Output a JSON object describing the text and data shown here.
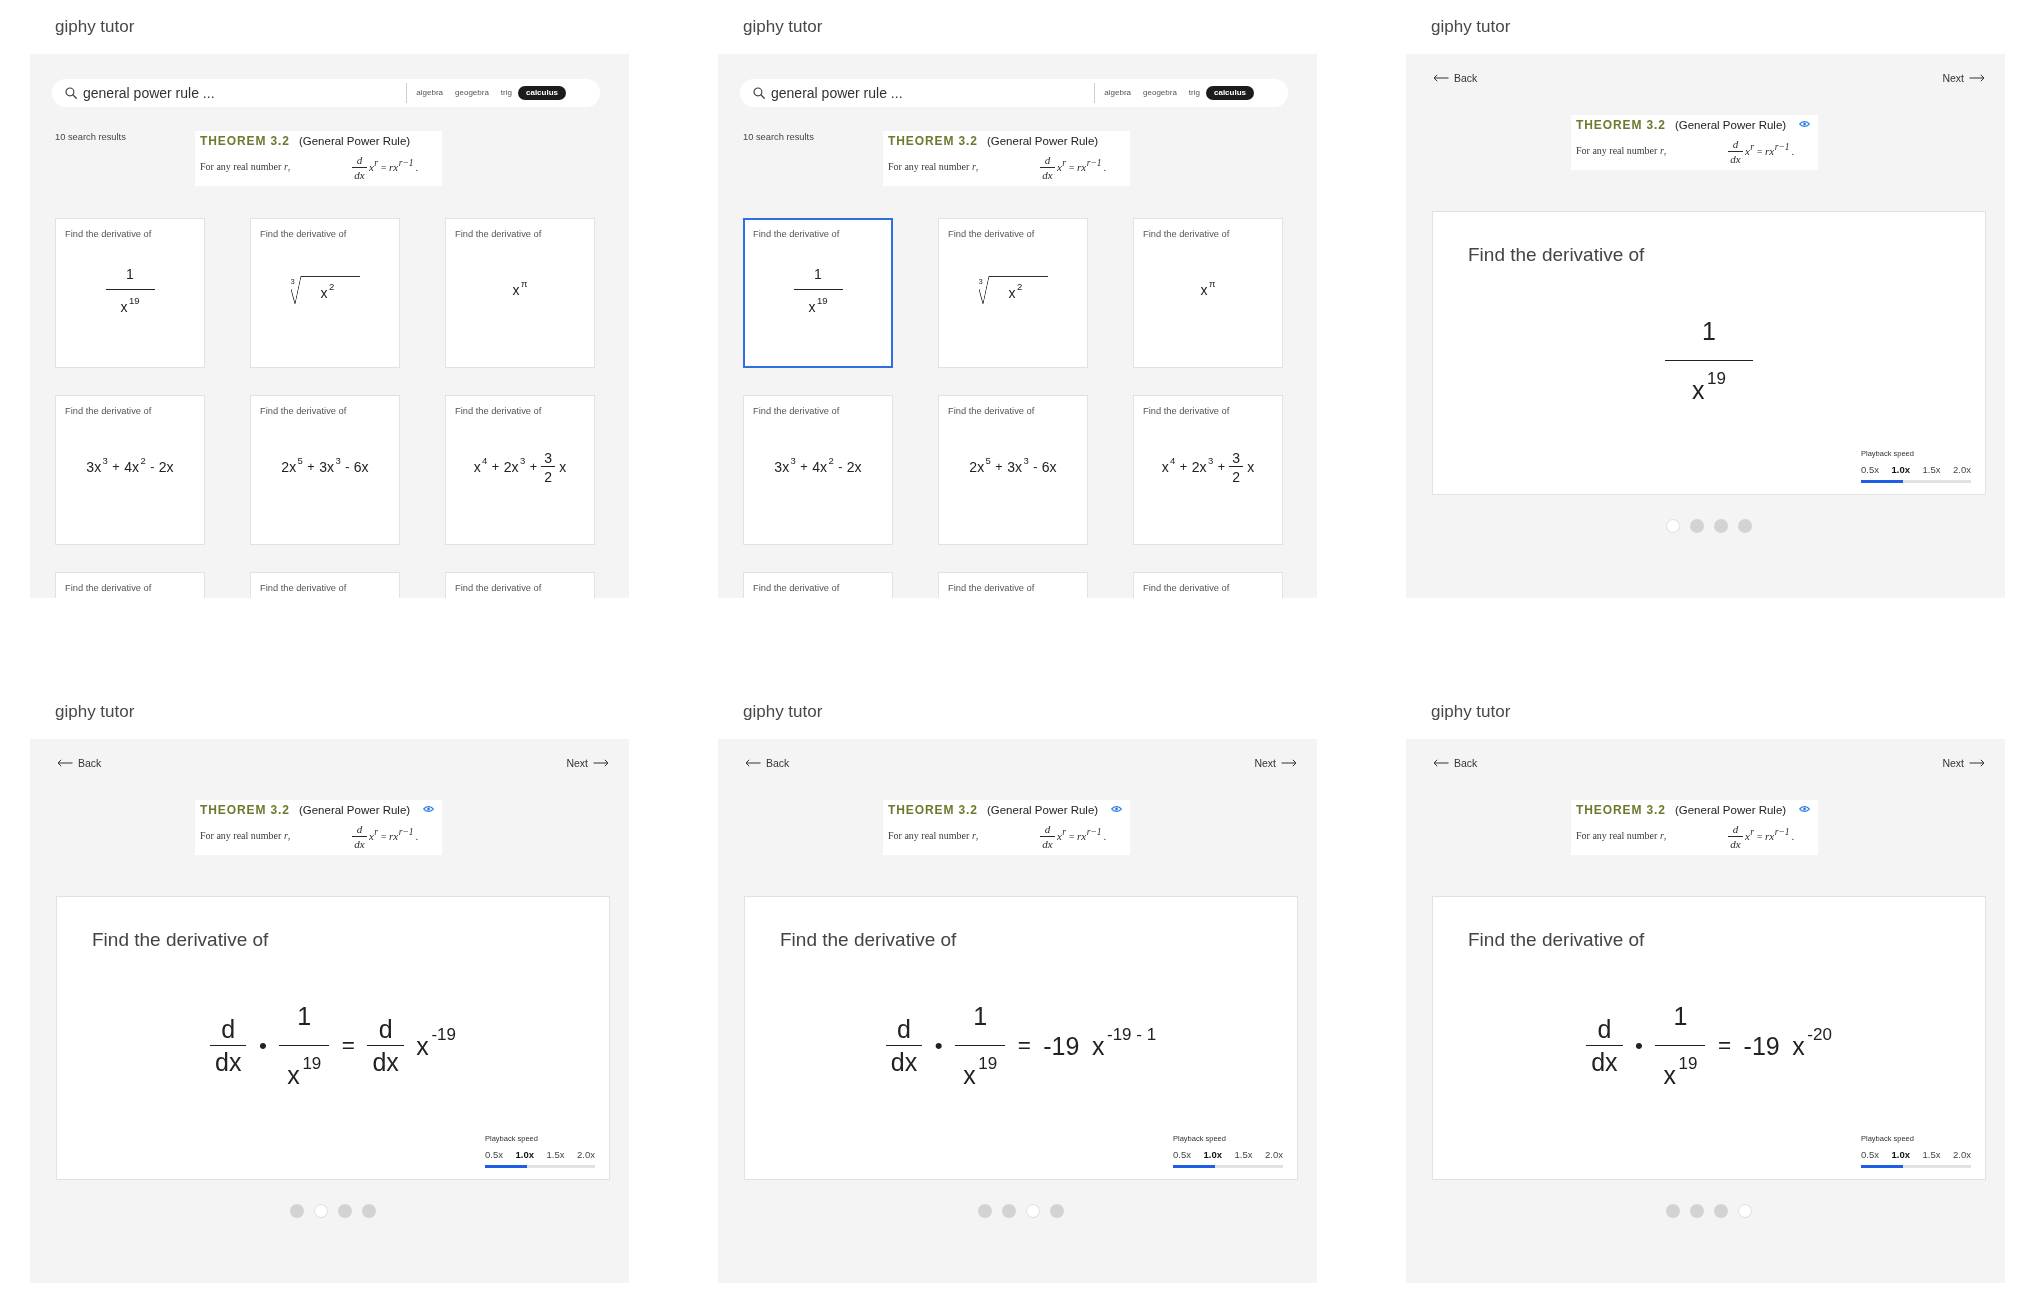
{
  "frames": [
    {
      "kind": "search",
      "app_title": "giphy tutor",
      "search": {
        "value": "general power rule ..."
      },
      "filters": [
        {
          "label": "algebra",
          "selected": false
        },
        {
          "label": "geogebra",
          "selected": false
        },
        {
          "label": "trig",
          "selected": false
        },
        {
          "label": "calculus",
          "selected": true
        }
      ],
      "result_count": "10 search results",
      "theorem": {
        "heading": "THEOREM 3.2",
        "name": "(General Power Rule)",
        "statement": "For any real number *r*,",
        "formula": [
          {
            "kind": "frac",
            "num": [
              {
                "kind": "text",
                "text": "d"
              }
            ],
            "den": [
              {
                "kind": "text",
                "text": "dx"
              }
            ]
          },
          {
            "kind": "pow",
            "base": "x",
            "exp": "r"
          },
          {
            "kind": "op",
            "text": "="
          },
          {
            "kind": "pow",
            "base": "rx",
            "exp": "r−1"
          },
          {
            "kind": "text",
            "text": "."
          }
        ]
      },
      "cards": [
        {
          "prompt": "Find the derivative of",
          "selected": false,
          "expression": [
            {
              "kind": "frac",
              "num": [
                {
                  "kind": "text",
                  "text": "1"
                }
              ],
              "den": [
                {
                  "kind": "pow",
                  "base": "x",
                  "exp": "19"
                }
              ]
            }
          ]
        },
        {
          "prompt": "Find the derivative of",
          "selected": false,
          "expression": [
            {
              "kind": "root",
              "index": "3",
              "body": [
                {
                  "kind": "pow",
                  "base": "x",
                  "exp": "2"
                }
              ]
            }
          ]
        },
        {
          "prompt": "Find the derivative of",
          "selected": false,
          "expression": [
            {
              "kind": "pow",
              "base": "x",
              "exp": "π"
            }
          ]
        },
        {
          "prompt": "Find the derivative of",
          "selected": false,
          "expression": [
            {
              "kind": "pow",
              "base": "3x",
              "exp": "3"
            },
            {
              "kind": "op",
              "text": "+"
            },
            {
              "kind": "pow",
              "base": "4x",
              "exp": "2"
            },
            {
              "kind": "op",
              "text": "-"
            },
            {
              "kind": "text",
              "text": "2x"
            }
          ]
        },
        {
          "prompt": "Find the derivative of",
          "selected": false,
          "expression": [
            {
              "kind": "pow",
              "base": "2x",
              "exp": "5"
            },
            {
              "kind": "op",
              "text": "+"
            },
            {
              "kind": "pow",
              "base": "3x",
              "exp": "3"
            },
            {
              "kind": "op",
              "text": "-"
            },
            {
              "kind": "text",
              "text": "6x"
            }
          ]
        },
        {
          "prompt": "Find the derivative of",
          "selected": false,
          "expression": [
            {
              "kind": "pow",
              "base": "x",
              "exp": "4"
            },
            {
              "kind": "op",
              "text": "+"
            },
            {
              "kind": "pow",
              "base": "2x",
              "exp": "3"
            },
            {
              "kind": "op",
              "text": "+"
            },
            {
              "kind": "frac",
              "num": [
                {
                  "kind": "text",
                  "text": "3"
                }
              ],
              "den": [
                {
                  "kind": "text",
                  "text": "2"
                }
              ]
            },
            {
              "kind": "text",
              "text": "x"
            }
          ]
        },
        {
          "prompt": "Find the derivative of",
          "selected": false
        },
        {
          "prompt": "Find the derivative of",
          "selected": false
        },
        {
          "prompt": "Find the derivative of",
          "selected": false
        }
      ]
    },
    {
      "kind": "search",
      "app_title": "giphy tutor",
      "search": {
        "value": "general power rule ..."
      },
      "filters": [
        {
          "label": "algebra",
          "selected": false
        },
        {
          "label": "geogebra",
          "selected": false
        },
        {
          "label": "trig",
          "selected": false
        },
        {
          "label": "calculus",
          "selected": true
        }
      ],
      "result_count": "10 search results",
      "theorem": {
        "heading": "THEOREM 3.2",
        "name": "(General Power Rule)",
        "statement": "For any real number *r*,",
        "formula": [
          {
            "kind": "frac",
            "num": [
              {
                "kind": "text",
                "text": "d"
              }
            ],
            "den": [
              {
                "kind": "text",
                "text": "dx"
              }
            ]
          },
          {
            "kind": "pow",
            "base": "x",
            "exp": "r"
          },
          {
            "kind": "op",
            "text": "="
          },
          {
            "kind": "pow",
            "base": "rx",
            "exp": "r−1"
          },
          {
            "kind": "text",
            "text": "."
          }
        ]
      },
      "cards": [
        {
          "prompt": "Find the derivative of",
          "selected": true,
          "expression": [
            {
              "kind": "frac",
              "num": [
                {
                  "kind": "text",
                  "text": "1"
                }
              ],
              "den": [
                {
                  "kind": "pow",
                  "base": "x",
                  "exp": "19"
                }
              ]
            }
          ]
        },
        {
          "prompt": "Find the derivative of",
          "selected": false,
          "expression": [
            {
              "kind": "root",
              "index": "3",
              "body": [
                {
                  "kind": "pow",
                  "base": "x",
                  "exp": "2"
                }
              ]
            }
          ]
        },
        {
          "prompt": "Find the derivative of",
          "selected": false,
          "expression": [
            {
              "kind": "pow",
              "base": "x",
              "exp": "π"
            }
          ]
        },
        {
          "prompt": "Find the derivative of",
          "selected": false,
          "expression": [
            {
              "kind": "pow",
              "base": "3x",
              "exp": "3"
            },
            {
              "kind": "op",
              "text": "+"
            },
            {
              "kind": "pow",
              "base": "4x",
              "exp": "2"
            },
            {
              "kind": "op",
              "text": "-"
            },
            {
              "kind": "text",
              "text": "2x"
            }
          ]
        },
        {
          "prompt": "Find the derivative of",
          "selected": false,
          "expression": [
            {
              "kind": "pow",
              "base": "2x",
              "exp": "5"
            },
            {
              "kind": "op",
              "text": "+"
            },
            {
              "kind": "pow",
              "base": "3x",
              "exp": "3"
            },
            {
              "kind": "op",
              "text": "-"
            },
            {
              "kind": "text",
              "text": "6x"
            }
          ]
        },
        {
          "prompt": "Find the derivative of",
          "selected": false,
          "expression": [
            {
              "kind": "pow",
              "base": "x",
              "exp": "4"
            },
            {
              "kind": "op",
              "text": "+"
            },
            {
              "kind": "pow",
              "base": "2x",
              "exp": "3"
            },
            {
              "kind": "op",
              "text": "+"
            },
            {
              "kind": "frac",
              "num": [
                {
                  "kind": "text",
                  "text": "3"
                }
              ],
              "den": [
                {
                  "kind": "text",
                  "text": "2"
                }
              ]
            },
            {
              "kind": "text",
              "text": "x"
            }
          ]
        },
        {
          "prompt": "Find the derivative of",
          "selected": false
        },
        {
          "prompt": "Find the derivative of",
          "selected": false
        },
        {
          "prompt": "Find the derivative of",
          "selected": false
        }
      ]
    },
    {
      "kind": "detail",
      "app_title": "giphy tutor",
      "back": "Back",
      "next": "Next",
      "theorem": {
        "heading": "THEOREM 3.2",
        "name": "(General Power Rule)",
        "statement": "For any real number *r*,",
        "formula": [
          {
            "kind": "frac",
            "num": [
              {
                "kind": "text",
                "text": "d"
              }
            ],
            "den": [
              {
                "kind": "text",
                "text": "dx"
              }
            ]
          },
          {
            "kind": "pow",
            "base": "x",
            "exp": "r"
          },
          {
            "kind": "op",
            "text": "="
          },
          {
            "kind": "pow",
            "base": "rx",
            "exp": "r−1"
          },
          {
            "kind": "text",
            "text": "."
          }
        ]
      },
      "prompt": "Find the derivative of",
      "expression": [
        {
          "kind": "frac",
          "num": [
            {
              "kind": "text",
              "text": "1"
            }
          ],
          "den": [
            {
              "kind": "pow",
              "base": "x",
              "exp": "19"
            }
          ]
        }
      ],
      "playback": {
        "label": "Playback speed",
        "speeds": [
          {
            "label": "0.5x",
            "selected": false
          },
          {
            "label": "1.0x",
            "selected": true
          },
          {
            "label": "1.5x",
            "selected": false
          },
          {
            "label": "2.0x",
            "selected": false
          }
        ],
        "level": 0.38
      },
      "steps": [
        {
          "selected": true
        },
        {
          "selected": false
        },
        {
          "selected": false
        },
        {
          "selected": false
        }
      ]
    },
    {
      "kind": "detail",
      "app_title": "giphy tutor",
      "back": "Back",
      "next": "Next",
      "theorem": {
        "heading": "THEOREM 3.2",
        "name": "(General Power Rule)",
        "statement": "For any real number *r*,",
        "formula": [
          {
            "kind": "frac",
            "num": [
              {
                "kind": "text",
                "text": "d"
              }
            ],
            "den": [
              {
                "kind": "text",
                "text": "dx"
              }
            ]
          },
          {
            "kind": "pow",
            "base": "x",
            "exp": "r"
          },
          {
            "kind": "op",
            "text": "="
          },
          {
            "kind": "pow",
            "base": "rx",
            "exp": "r−1"
          },
          {
            "kind": "text",
            "text": "."
          }
        ]
      },
      "prompt": "Find the derivative of",
      "expression": [
        {
          "kind": "frac",
          "num": [
            {
              "kind": "text",
              "text": "d"
            }
          ],
          "den": [
            {
              "kind": "text",
              "text": "dx"
            }
          ]
        },
        {
          "kind": "op",
          "text": "•"
        },
        {
          "kind": "frac",
          "num": [
            {
              "kind": "text",
              "text": "1"
            }
          ],
          "den": [
            {
              "kind": "pow",
              "base": "x",
              "exp": "19"
            }
          ]
        },
        {
          "kind": "op",
          "text": "="
        },
        {
          "kind": "frac",
          "num": [
            {
              "kind": "text",
              "text": "d"
            }
          ],
          "den": [
            {
              "kind": "text",
              "text": "dx"
            }
          ]
        },
        {
          "kind": "pow",
          "base": "x",
          "exp": "-19"
        }
      ],
      "playback": {
        "label": "Playback speed",
        "speeds": [
          {
            "label": "0.5x",
            "selected": false
          },
          {
            "label": "1.0x",
            "selected": true
          },
          {
            "label": "1.5x",
            "selected": false
          },
          {
            "label": "2.0x",
            "selected": false
          }
        ],
        "level": 0.38
      },
      "steps": [
        {
          "selected": false
        },
        {
          "selected": true
        },
        {
          "selected": false
        },
        {
          "selected": false
        }
      ]
    },
    {
      "kind": "detail",
      "app_title": "giphy tutor",
      "back": "Back",
      "next": "Next",
      "theorem": {
        "heading": "THEOREM 3.2",
        "name": "(General Power Rule)",
        "statement": "For any real number *r*,",
        "formula": [
          {
            "kind": "frac",
            "num": [
              {
                "kind": "text",
                "text": "d"
              }
            ],
            "den": [
              {
                "kind": "text",
                "text": "dx"
              }
            ]
          },
          {
            "kind": "pow",
            "base": "x",
            "exp": "r"
          },
          {
            "kind": "op",
            "text": "="
          },
          {
            "kind": "pow",
            "base": "rx",
            "exp": "r−1"
          },
          {
            "kind": "text",
            "text": "."
          }
        ]
      },
      "prompt": "Find the derivative of",
      "expression": [
        {
          "kind": "frac",
          "num": [
            {
              "kind": "text",
              "text": "d"
            }
          ],
          "den": [
            {
              "kind": "text",
              "text": "dx"
            }
          ]
        },
        {
          "kind": "op",
          "text": "•"
        },
        {
          "kind": "frac",
          "num": [
            {
              "kind": "text",
              "text": "1"
            }
          ],
          "den": [
            {
              "kind": "pow",
              "base": "x",
              "exp": "19"
            }
          ]
        },
        {
          "kind": "op",
          "text": "="
        },
        {
          "kind": "text",
          "text": "-19"
        },
        {
          "kind": "pow",
          "base": "x",
          "exp": "-19 - 1"
        }
      ],
      "playback": {
        "label": "Playback speed",
        "speeds": [
          {
            "label": "0.5x",
            "selected": false
          },
          {
            "label": "1.0x",
            "selected": true
          },
          {
            "label": "1.5x",
            "selected": false
          },
          {
            "label": "2.0x",
            "selected": false
          }
        ],
        "level": 0.38
      },
      "steps": [
        {
          "selected": false
        },
        {
          "selected": false
        },
        {
          "selected": true
        },
        {
          "selected": false
        }
      ]
    },
    {
      "kind": "detail",
      "app_title": "giphy tutor",
      "back": "Back",
      "next": "Next",
      "theorem": {
        "heading": "THEOREM 3.2",
        "name": "(General Power Rule)",
        "statement": "For any real number *r*,",
        "formula": [
          {
            "kind": "frac",
            "num": [
              {
                "kind": "text",
                "text": "d"
              }
            ],
            "den": [
              {
                "kind": "text",
                "text": "dx"
              }
            ]
          },
          {
            "kind": "pow",
            "base": "x",
            "exp": "r"
          },
          {
            "kind": "op",
            "text": "="
          },
          {
            "kind": "pow",
            "base": "rx",
            "exp": "r−1"
          },
          {
            "kind": "text",
            "text": "."
          }
        ]
      },
      "prompt": "Find the derivative of",
      "expression": [
        {
          "kind": "frac",
          "num": [
            {
              "kind": "text",
              "text": "d"
            }
          ],
          "den": [
            {
              "kind": "text",
              "text": "dx"
            }
          ]
        },
        {
          "kind": "op",
          "text": "•"
        },
        {
          "kind": "frac",
          "num": [
            {
              "kind": "text",
              "text": "1"
            }
          ],
          "den": [
            {
              "kind": "pow",
              "base": "x",
              "exp": "19"
            }
          ]
        },
        {
          "kind": "op",
          "text": "="
        },
        {
          "kind": "text",
          "text": "-19"
        },
        {
          "kind": "pow",
          "base": "x",
          "exp": "-20"
        }
      ],
      "playback": {
        "label": "Playback speed",
        "speeds": [
          {
            "label": "0.5x",
            "selected": false
          },
          {
            "label": "1.0x",
            "selected": true
          },
          {
            "label": "1.5x",
            "selected": false
          },
          {
            "label": "2.0x",
            "selected": false
          }
        ],
        "level": 0.38
      },
      "steps": [
        {
          "selected": false
        },
        {
          "selected": false
        },
        {
          "selected": false
        },
        {
          "selected": true
        }
      ]
    }
  ]
}
